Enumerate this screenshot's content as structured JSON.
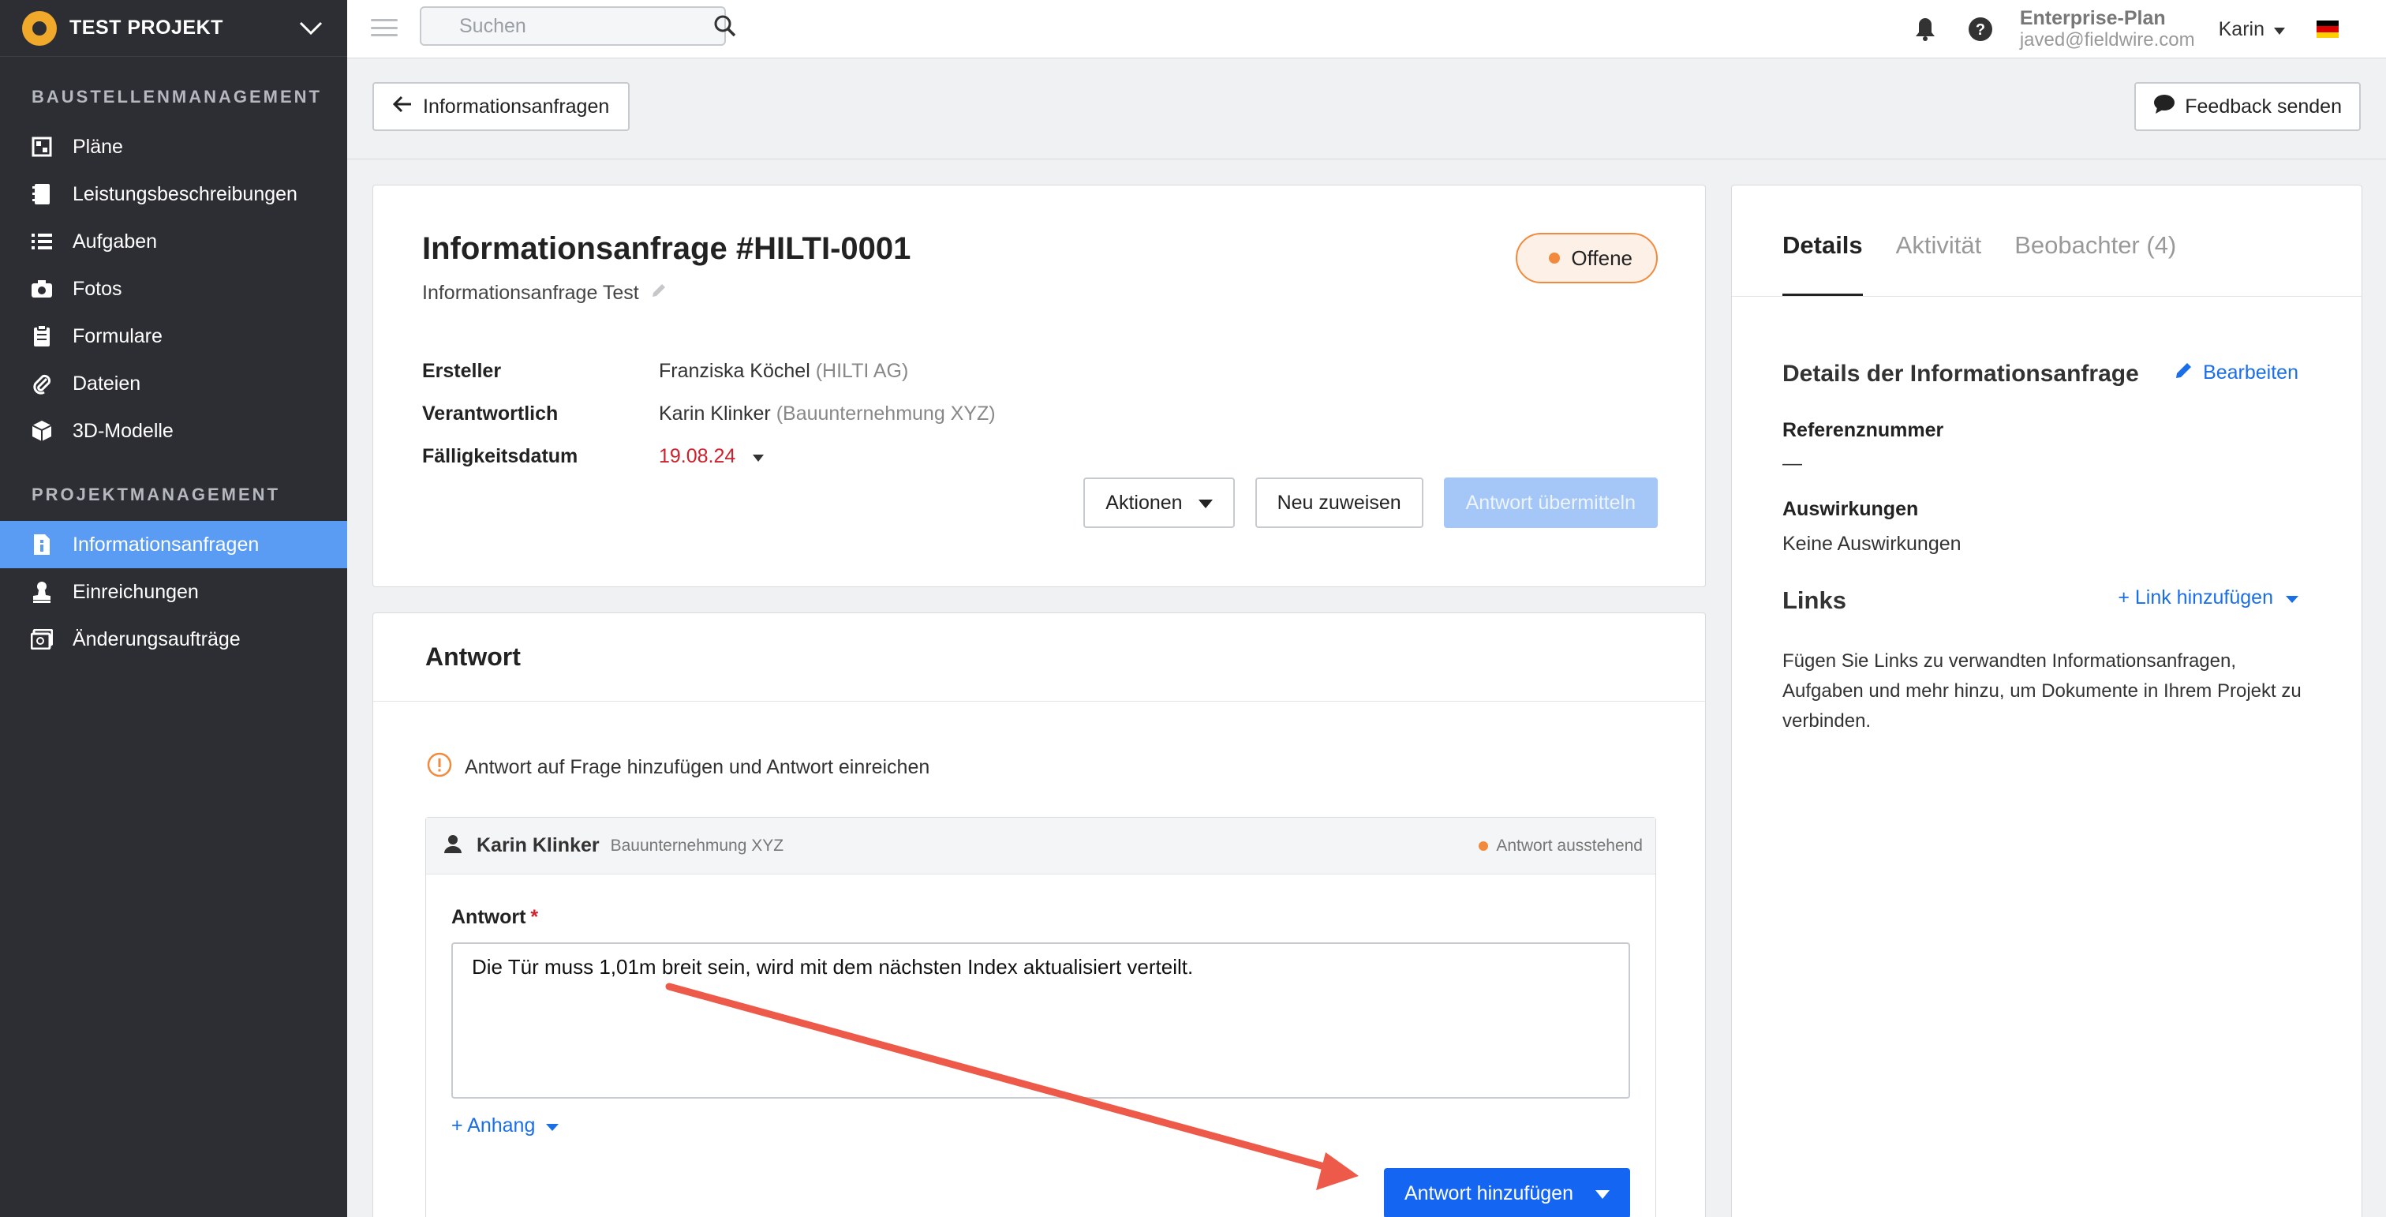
{
  "project": {
    "name": "TEST PROJEKT"
  },
  "sidebar": {
    "section1": "BAUSTELLENMANAGEMENT",
    "items1": [
      {
        "label": "Pläne",
        "icon": "plans-icon"
      },
      {
        "label": "Leistungsbeschreibungen",
        "icon": "specs-icon"
      },
      {
        "label": "Aufgaben",
        "icon": "tasks-icon"
      },
      {
        "label": "Fotos",
        "icon": "camera-icon"
      },
      {
        "label": "Formulare",
        "icon": "clipboard-icon"
      },
      {
        "label": "Dateien",
        "icon": "paperclip-icon"
      },
      {
        "label": "3D-Modelle",
        "icon": "cube-icon"
      }
    ],
    "section2": "PROJEKTMANAGEMENT",
    "items2": [
      {
        "label": "Informationsanfragen",
        "icon": "info-doc-icon",
        "active": true
      },
      {
        "label": "Einreichungen",
        "icon": "stamp-icon"
      },
      {
        "label": "Änderungsaufträge",
        "icon": "change-order-icon"
      }
    ]
  },
  "topbar": {
    "search_placeholder": "Suchen",
    "plan": "Enterprise-Plan",
    "email": "javed@fieldwire.com",
    "user": "Karin"
  },
  "subheader": {
    "back_label": "Informationsanfragen",
    "feedback_label": "Feedback senden"
  },
  "rfi": {
    "title": "Informationsanfrage #HILTI-0001",
    "subtitle": "Informationsanfrage Test",
    "status": "Offene",
    "meta": {
      "creator_label": "Ersteller",
      "creator_name": "Franziska Köchel",
      "creator_org": "(HILTI AG)",
      "assignee_label": "Verantwortlich",
      "assignee_name": "Karin Klinker",
      "assignee_org": "(Bauunternehmung XYZ)",
      "due_label": "Fälligkeitsdatum",
      "due_date": "19.08.24"
    },
    "actions": {
      "actions_label": "Aktionen",
      "reassign_label": "Neu zuweisen",
      "submit_label": "Antwort übermitteln"
    }
  },
  "answer": {
    "heading": "Antwort",
    "notice": "Antwort auf Frage hinzufügen und Antwort einreichen",
    "responder_name": "Karin Klinker",
    "responder_org": "Bauunternehmung XYZ",
    "status": "Antwort ausstehend",
    "field_label": "Antwort",
    "required_mark": "*",
    "text": "Die Tür muss 1,01m breit sein, wird mit dem nächsten Index aktualisiert verteilt.",
    "attach_label": "+ Anhang",
    "add_button": "Antwort hinzufügen"
  },
  "details": {
    "tabs": [
      "Details",
      "Aktivität",
      "Beobachter (4)"
    ],
    "title": "Details der Informationsanfrage",
    "edit_label": "Bearbeiten",
    "ref_label": "Referenznummer",
    "ref_value": "—",
    "impact_label": "Auswirkungen",
    "impact_value": "Keine Auswirkungen",
    "links_title": "Links",
    "add_link_label": "+ Link hinzufügen",
    "links_desc": "Fügen Sie Links zu verwandten Informationsanfragen, Aufgaben und mehr hinzu, um Dokumente in Ihrem Projekt zu verbinden."
  },
  "colors": {
    "sidebar_bg": "#2c2e33",
    "active_nav": "#5a9cf3",
    "primary": "#1466f2",
    "status_orange": "#f28a3d",
    "due_red": "#d0202c",
    "annotation_arrow": "#ee5a4a"
  }
}
